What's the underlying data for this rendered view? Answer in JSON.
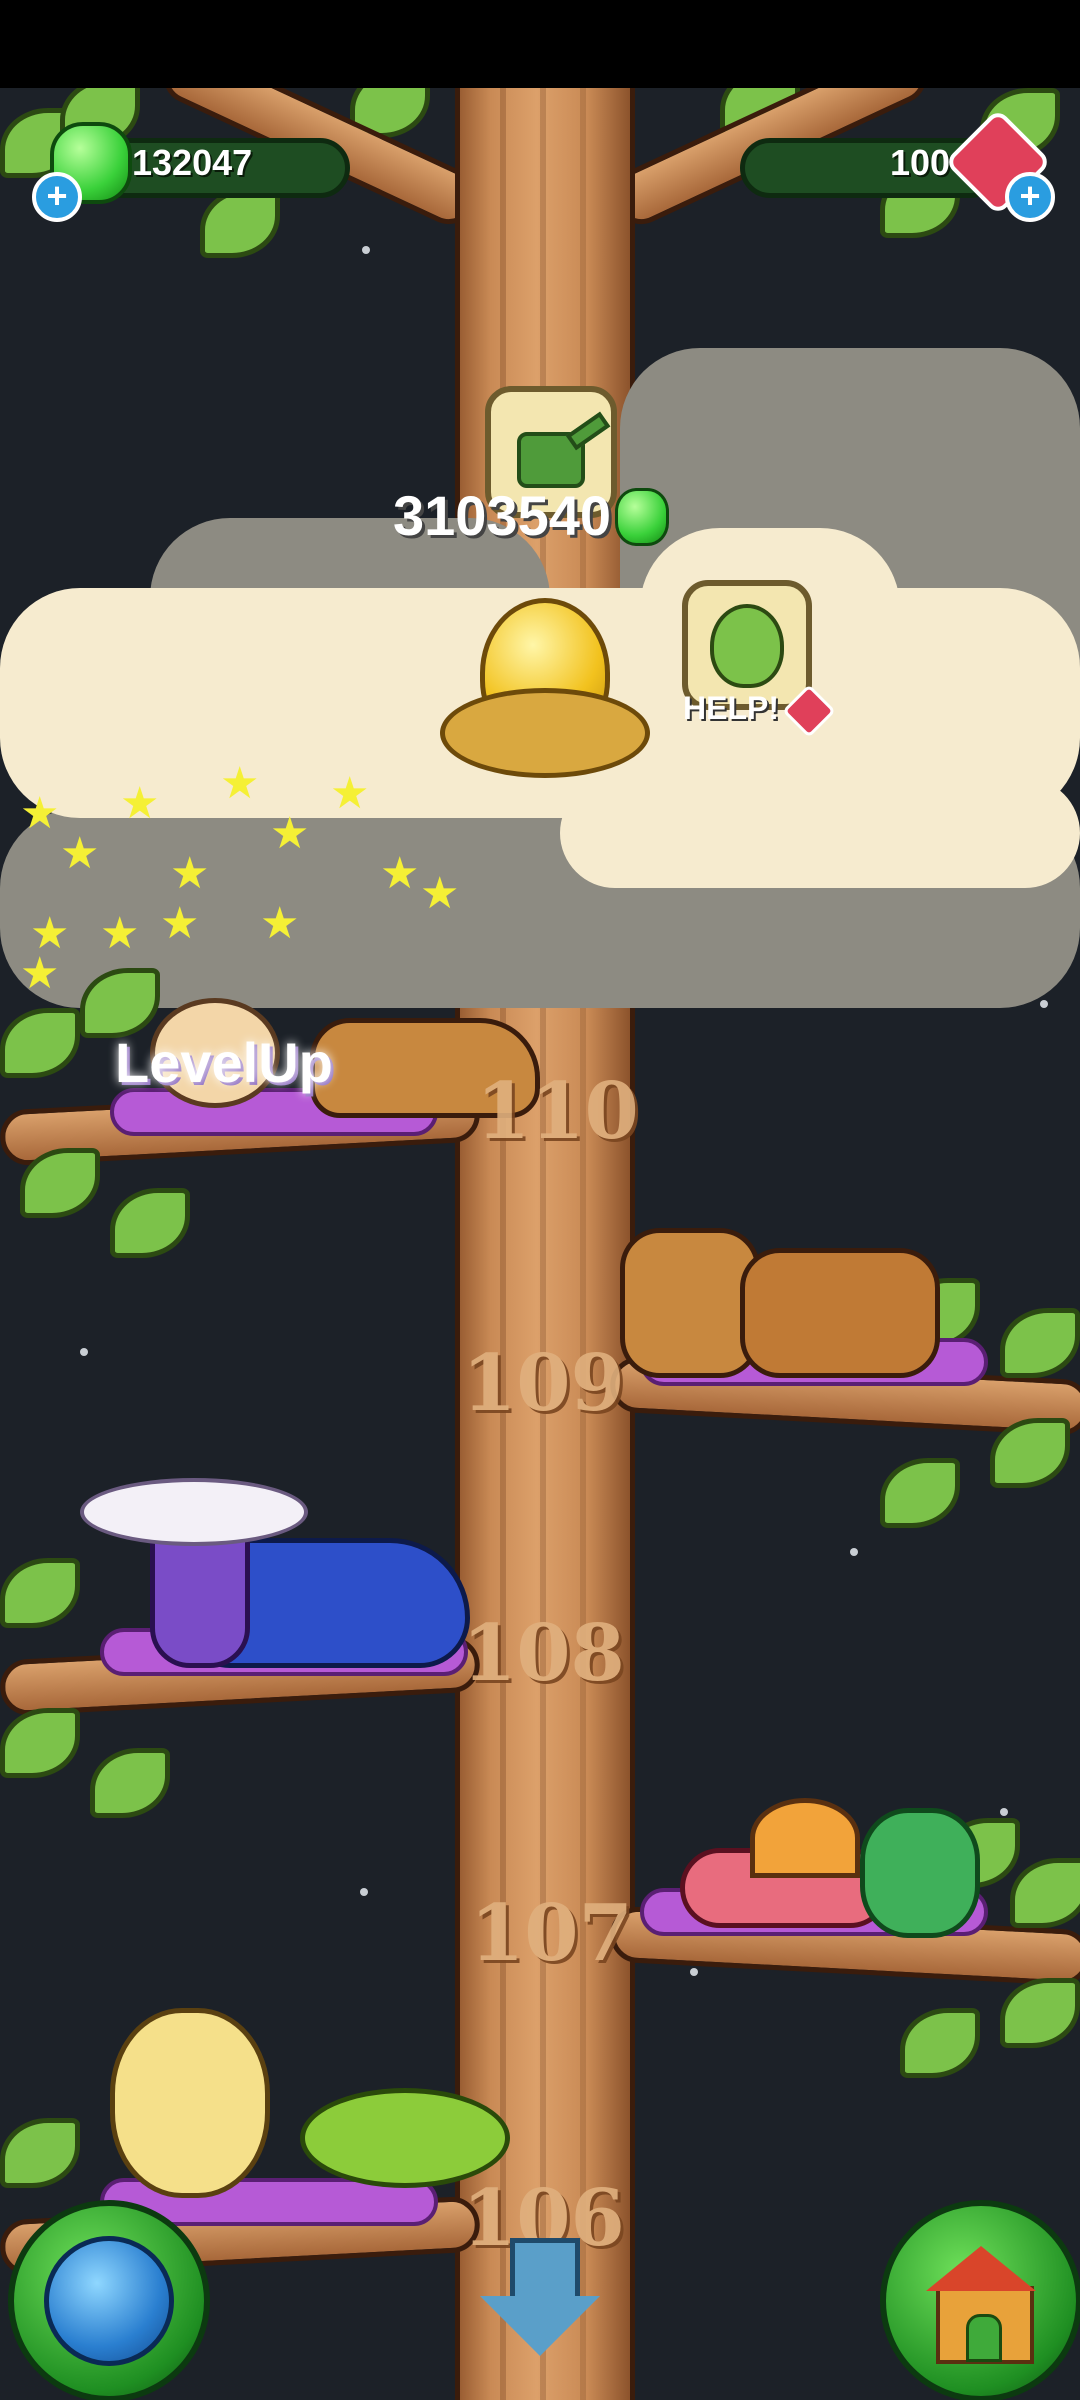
{
  "hud": {
    "gems_count": "132047",
    "crystals_count": "100",
    "add_gems_label": "+",
    "add_crystals_label": "+"
  },
  "top_reward": {
    "amount": "3103540",
    "tool_icon": "watering-can-icon"
  },
  "help_bubble": {
    "label": "HELP!"
  },
  "level_up_label": "LevelUp",
  "levels": [
    "110",
    "109",
    "108",
    "107",
    "106"
  ],
  "buttons": {
    "world_icon": "globe-icon",
    "home_icon": "house-icon",
    "scroll_down_icon": "arrow-down-icon"
  },
  "colors": {
    "night_sky": "#1c2128",
    "trunk": "#c98a55",
    "leaf": "#7cc24a",
    "hud_green": "#1e4d22",
    "gem_green": "#3ad13a",
    "crystal_red": "#e0405a"
  }
}
